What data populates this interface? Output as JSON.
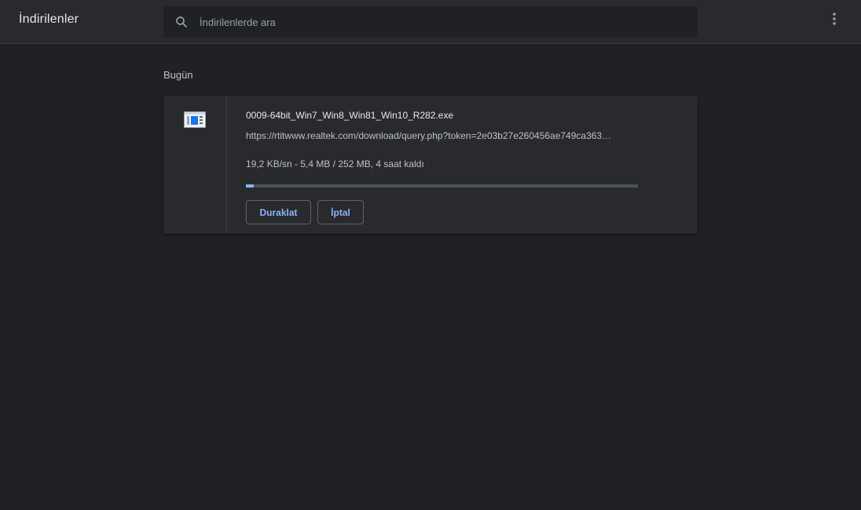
{
  "header": {
    "title": "İndirilenler",
    "search": {
      "placeholder": "İndirilenlerde ara",
      "value": "",
      "icon": "search-icon"
    },
    "menu_icon": "more-vert-icon"
  },
  "downloads": {
    "section_label": "Bugün",
    "items": [
      {
        "file_icon": "exe-file-icon",
        "file_name": "0009-64bit_Win7_Win8_Win81_Win10_R282.exe",
        "url": "https://rtitwww.realtek.com/download/query.php?token=2e03b27e260456ae749ca363…",
        "status": "19,2 KB/sn - 5,4 MB / 252 MB, 4 saat kaldı",
        "progress_fraction": 0.021,
        "pause_label": "Duraklat",
        "cancel_label": "İptal"
      }
    ]
  },
  "colors": {
    "background": "#202124",
    "toolbar": "#292a2d",
    "card": "#292a2d",
    "accent": "#8ab4f8",
    "text_primary": "#e8eaed",
    "text_secondary": "#bdc1c6"
  }
}
